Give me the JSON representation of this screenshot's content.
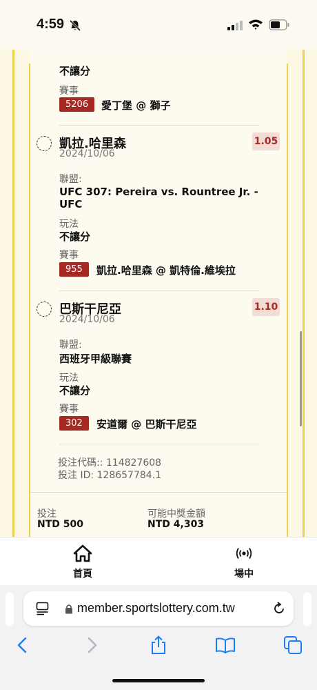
{
  "status_bar": {
    "time": "4:59"
  },
  "top_section": {
    "play_value": "不讓分",
    "event_label": "賽事",
    "event_code": "5206",
    "event_text": "愛丁堡 @ 獅子"
  },
  "selections": [
    {
      "name": "凱拉.哈里森",
      "date": "2024/10/06",
      "odds": "1.05",
      "league_label": "聯盟:",
      "league_value": "UFC 307: Pereira vs. Rountree Jr. - UFC",
      "league_line1": "UFC 307: Pereira vs. Rountree Jr. -",
      "league_line2": "UFC",
      "play_label": "玩法",
      "play_value": "不讓分",
      "event_label": "賽事",
      "event_code": "955",
      "event_text": "凱拉.哈里森 @ 凱特倫.維埃拉"
    },
    {
      "name": "巴斯干尼亞",
      "date": "2024/10/06",
      "odds": "1.10",
      "league_label": "聯盟:",
      "league_value": "西班牙甲級聯賽",
      "play_label": "玩法",
      "play_value": "不讓分",
      "event_label": "賽事",
      "event_code": "302",
      "event_text": "安道爾 @ 巴斯干尼亞"
    }
  ],
  "bet_meta": {
    "bet_code": "投注代碼:: 114827608",
    "bet_id": "投注 ID: 128657784.1"
  },
  "summary": {
    "stake_label": "投注",
    "stake_value": "NTD 500",
    "payout_label": "可能中獎金額",
    "payout_value": "NTD 4,303"
  },
  "tabbar": {
    "home_label": "首頁",
    "live_label": "場中",
    "home_icon": "home-icon",
    "live_icon": "broadcast-icon"
  },
  "browser": {
    "url": "member.sportslottery.com.tw"
  },
  "colors": {
    "accent_red": "#a52a23",
    "rail_yellow": "#f0cf4e",
    "odds_bg": "#f4dcd6"
  }
}
